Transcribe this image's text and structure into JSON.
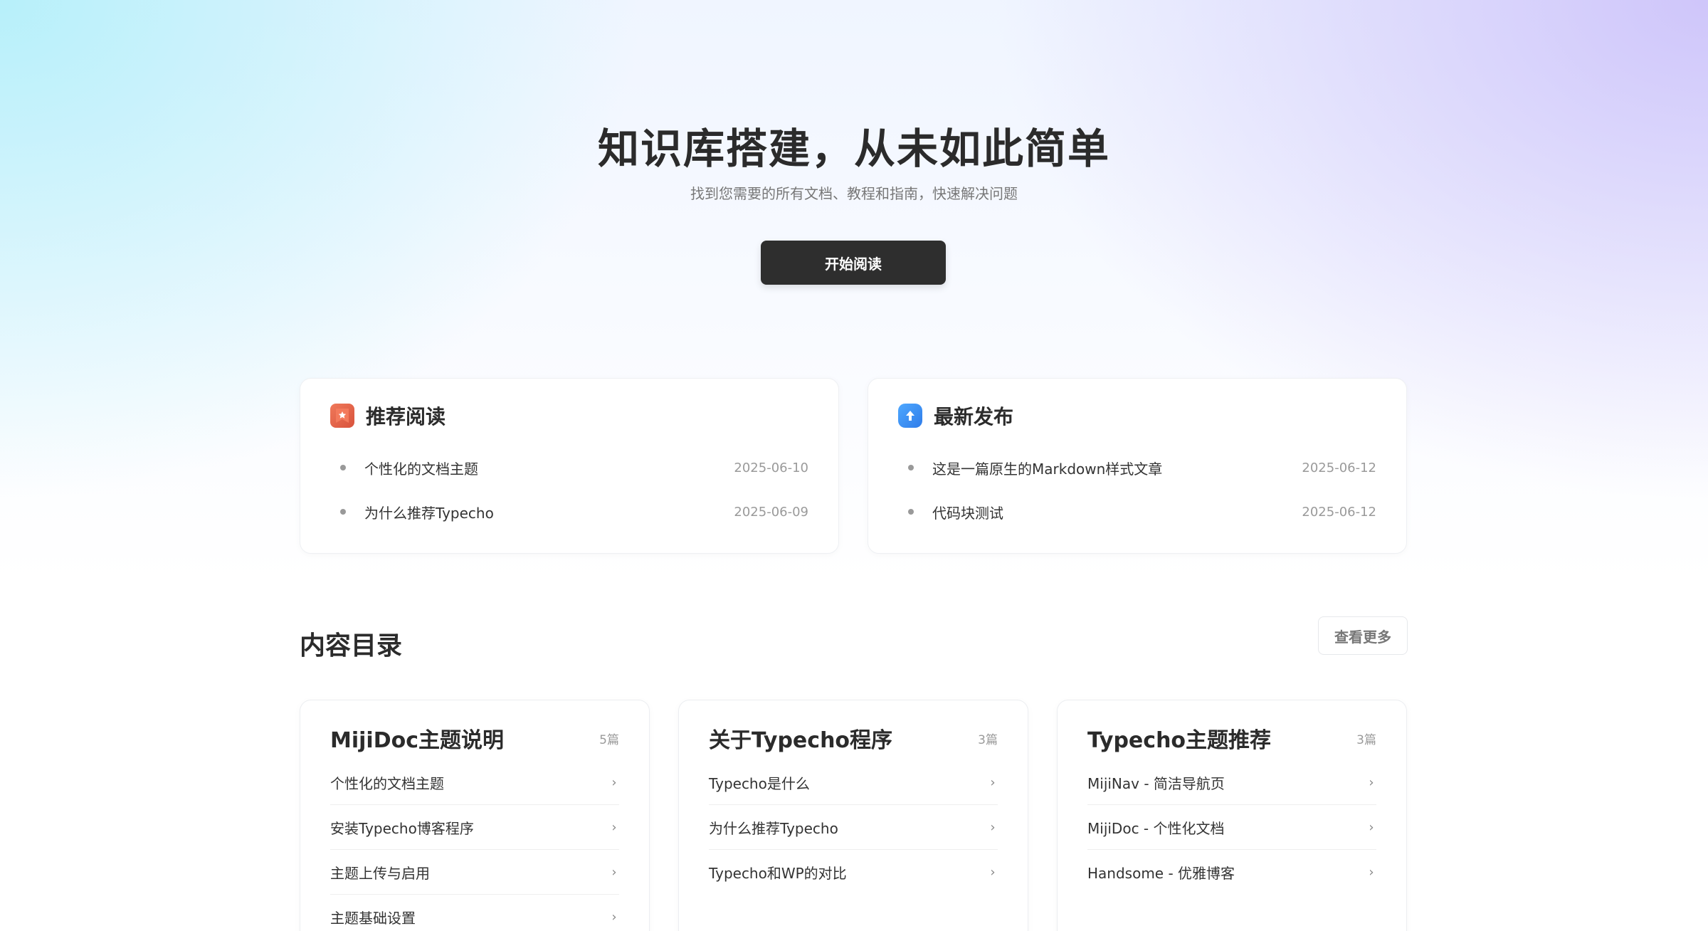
{
  "hero": {
    "title": "知识库搭建，从未如此简单",
    "subtitle": "找到您需要的所有文档、教程和指南，快速解决问题",
    "button_label": "开始阅读"
  },
  "recommended": {
    "title": "推荐阅读",
    "icon": "star-bookmark-icon",
    "items": [
      {
        "title": "个性化的文档主题",
        "date": "2025-06-10"
      },
      {
        "title": "为什么推荐Typecho",
        "date": "2025-06-09"
      }
    ]
  },
  "latest": {
    "title": "最新发布",
    "icon": "upload-arrow-icon",
    "items": [
      {
        "title": "这是一篇原生的Markdown样式文章",
        "date": "2025-06-12"
      },
      {
        "title": "代码块测试",
        "date": "2025-06-12"
      }
    ]
  },
  "catalog": {
    "title": "内容目录",
    "more_label": "查看更多",
    "categories": [
      {
        "title": "MijiDoc主题说明",
        "count": "5篇",
        "items": [
          "个性化的文档主题",
          "安装Typecho博客程序",
          "主题上传与启用",
          "主题基础设置"
        ]
      },
      {
        "title": "关于Typecho程序",
        "count": "3篇",
        "items": [
          "Typecho是什么",
          "为什么推荐Typecho",
          "Typecho和WP的对比"
        ]
      },
      {
        "title": "Typecho主题推荐",
        "count": "3篇",
        "items": [
          "MijiNav - 简洁导航页",
          "MijiDoc - 个性化文档",
          "Handsome - 优雅博客"
        ]
      }
    ]
  },
  "icons": {
    "chevron": "chevron-right-icon",
    "bullet": "bullet-dot-icon"
  }
}
